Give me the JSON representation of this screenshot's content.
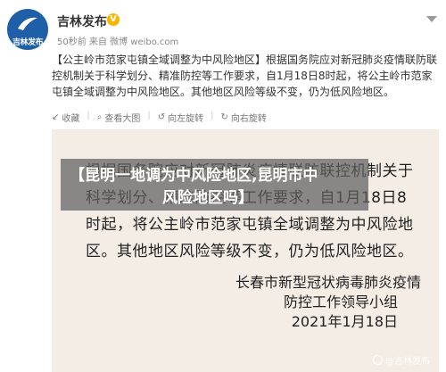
{
  "post": {
    "author": "吉林发布",
    "verified_badge": "V",
    "avatar_text": "吉林发布",
    "meta": "50秒前 来自 微博 weibo.com",
    "text": "【公主岭市范家屯镇全域调整为中风险地区】根据国务院应对新冠肺炎疫情联防联控机制关于科学划分、精准防控等工作要求，自1月18日8时起，将公主岭市范家屯镇全域调整为中风险地区。其他地区风险等级不变，仍为低风险地区。"
  },
  "actions": {
    "collect": "收藏",
    "view_large": "查看大图",
    "rotate_left": "向左旋转",
    "rotate_right": "向右旋转"
  },
  "notice": {
    "body": "根据国务院应对新冠肺炎疫情联防联控机制关于科学划分、精准防控等工作要求，自1月18日8时起，将公主岭市范家屯镇全域调整为中风险地区。其他地区风险等级不变，仍为低风险地区。",
    "signature_line1": "长春市新型冠状病毒肺炎疫情",
    "signature_line2": "防控工作领导小组",
    "date": "2021年1月18日"
  },
  "overlay": {
    "line1": "【昆明一地调为中风险地区,昆明市中",
    "line2": "风险地区吗】"
  },
  "watermark": "@吉林发布",
  "colors": {
    "avatar": "#1f5fa8",
    "badge": "#f7b500",
    "notice_bg": "#f3ede6"
  }
}
